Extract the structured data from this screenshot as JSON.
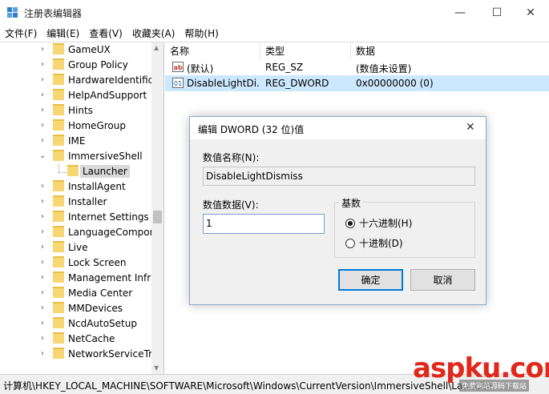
{
  "window": {
    "title": "注册表编辑器",
    "minimize_glyph": "—",
    "maximize_glyph": "☐",
    "close_glyph": "✕"
  },
  "menu": [
    "文件(F)",
    "编辑(E)",
    "查看(V)",
    "收藏夹(A)",
    "帮助(H)"
  ],
  "tree": {
    "items": [
      {
        "label": "GameUX",
        "expanded": false
      },
      {
        "label": "Group Policy",
        "expanded": false
      },
      {
        "label": "HardwareIdentifica",
        "expanded": false
      },
      {
        "label": "HelpAndSupport",
        "expanded": false
      },
      {
        "label": "Hints",
        "expanded": false
      },
      {
        "label": "HomeGroup",
        "expanded": false
      },
      {
        "label": "IME",
        "expanded": false
      },
      {
        "label": "ImmersiveShell",
        "expanded": true
      },
      {
        "label": "Launcher",
        "child": true,
        "selected": true
      },
      {
        "label": "InstallAgent",
        "expanded": false
      },
      {
        "label": "Installer",
        "expanded": false
      },
      {
        "label": "Internet Settings",
        "expanded": false
      },
      {
        "label": "LanguageCompone",
        "expanded": false
      },
      {
        "label": "Live",
        "expanded": false
      },
      {
        "label": "Lock Screen",
        "expanded": false
      },
      {
        "label": "Management Infra",
        "expanded": false
      },
      {
        "label": "Media Center",
        "expanded": false
      },
      {
        "label": "MMDevices",
        "expanded": false
      },
      {
        "label": "NcdAutoSetup",
        "expanded": false
      },
      {
        "label": "NetCache",
        "expanded": false
      },
      {
        "label": "NetworkServiceTrig",
        "expanded": false
      }
    ]
  },
  "values_pane": {
    "headers": {
      "name": "名称",
      "type": "类型",
      "data": "数据"
    },
    "rows": [
      {
        "icon": "ab",
        "name": "(默认)",
        "type": "REG_SZ",
        "data": "(数值未设置)"
      },
      {
        "icon": "bin",
        "name": "DisableLightDi...",
        "type": "REG_DWORD",
        "data": "0x00000000 (0)"
      }
    ]
  },
  "dialog": {
    "title": "编辑 DWORD (32 位)值",
    "name_label": "数值名称(N):",
    "name_value": "DisableLightDismiss",
    "data_label": "数值数据(V):",
    "data_value": "1",
    "base_label": "基数",
    "radio_hex": "十六进制(H)",
    "radio_dec": "十进制(D)",
    "ok": "确定",
    "cancel": "取消",
    "close_glyph": "✕"
  },
  "statusbar": {
    "path": "计算机\\HKEY_LOCAL_MACHINE\\SOFTWARE\\Microsoft\\Windows\\CurrentVersion\\ImmersiveShell\\Launcher"
  },
  "watermark": {
    "main": "aspku.com",
    "sub": "免费网站源码下载站"
  },
  "colors": {
    "selection": "#cce8ff",
    "accent": "#0078d7",
    "watermark": "#e0281c"
  }
}
